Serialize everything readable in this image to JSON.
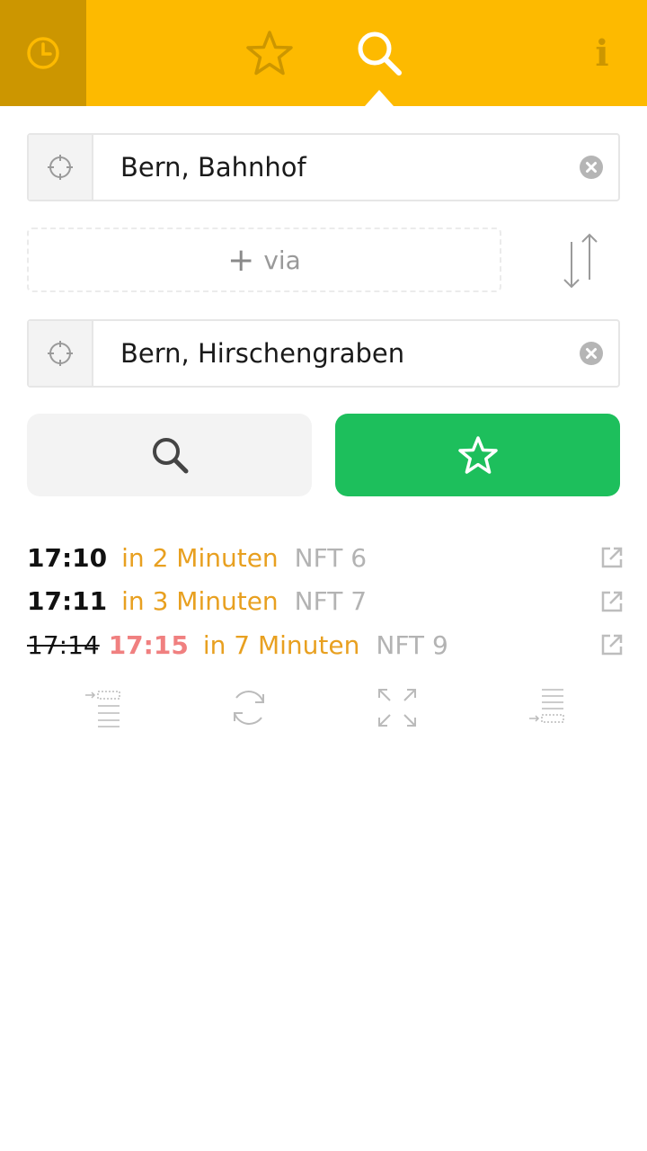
{
  "header": {
    "tabs": [
      {
        "icon": "clock-icon",
        "active": false
      },
      {
        "icon": "star-icon",
        "active": false
      },
      {
        "icon": "search-icon",
        "active": true
      },
      {
        "icon": "info-icon",
        "active": false
      }
    ],
    "info_label": "i",
    "colors": {
      "bar": "#FDBA00",
      "clock_tab": "#CC9600",
      "icon": "#CC9600",
      "active_icon": "#FFFFFF"
    }
  },
  "from": {
    "value": "Bern, Bahnhof"
  },
  "via": {
    "plus": "+",
    "label": "via"
  },
  "to": {
    "value": "Bern, Hirschengraben"
  },
  "actions": {
    "search_icon": "search-icon",
    "favorite_icon": "star-outline-icon",
    "favorite_color": "#1DBF5C"
  },
  "departures": [
    {
      "time": "17:10",
      "relative": "in 2 Minuten",
      "line": "NFT 6"
    },
    {
      "time": "17:11",
      "relative": "in 3 Minuten",
      "line": "NFT 7"
    },
    {
      "scheduled": "17:14",
      "actual": "17:15",
      "relative": "in 7 Minuten",
      "line": "NFT 9"
    }
  ],
  "tools": [
    "earlier-icon",
    "refresh-icon",
    "expand-icon",
    "later-icon"
  ]
}
